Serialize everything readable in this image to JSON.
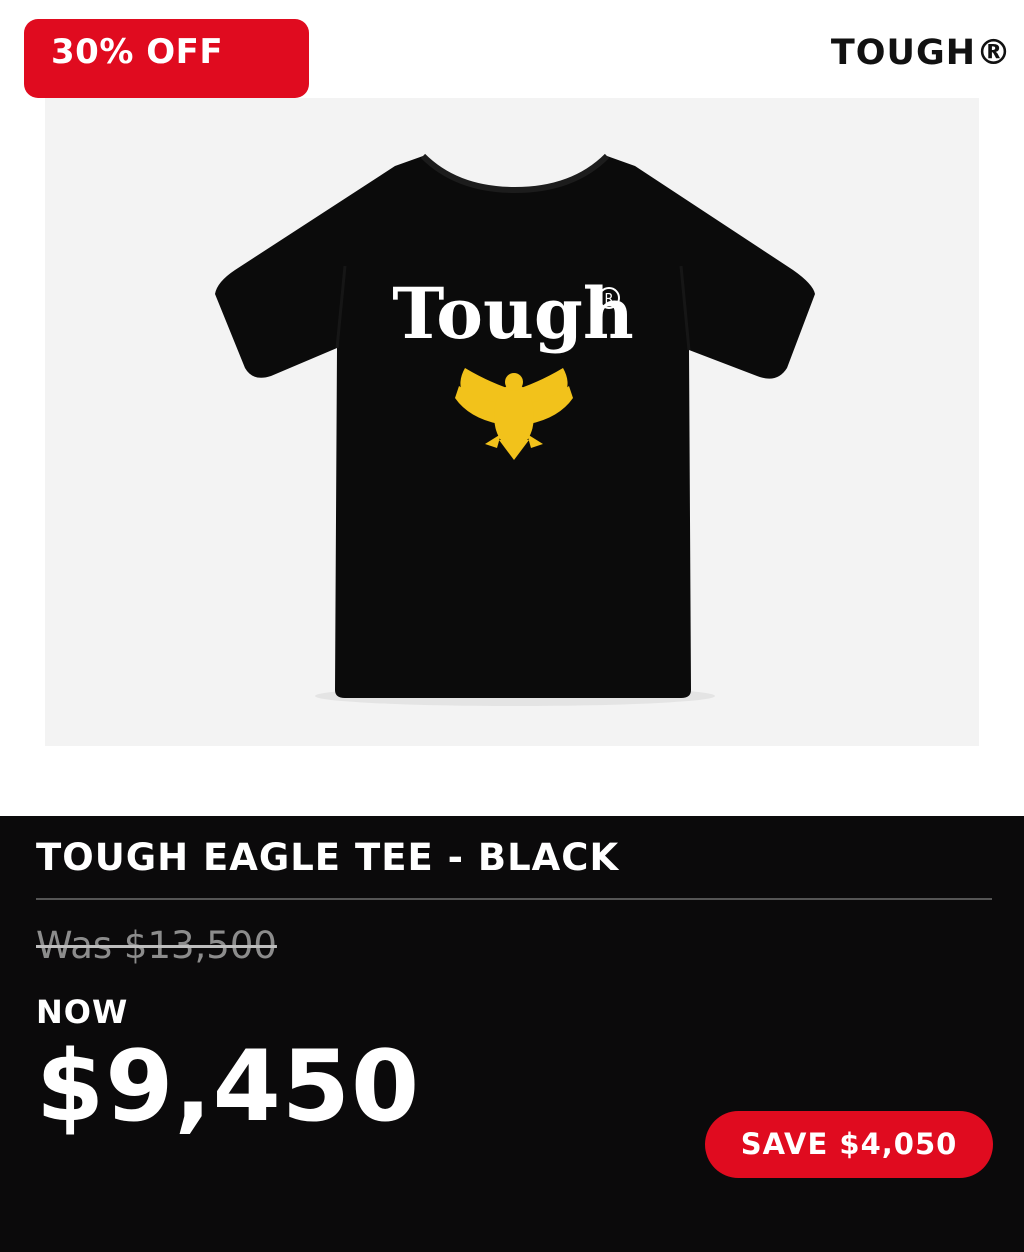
{
  "badge": {
    "discount_label": "30% OFF"
  },
  "header": {
    "brand": "TOUGH®"
  },
  "product_image": {
    "description_icon": "t-shirt-photo",
    "shirt_print_text": "Tough",
    "shirt_color": "#0a0a0a",
    "print_color": "#ffffff",
    "eagle_color": "#f2c21b"
  },
  "product": {
    "title": "TOUGH EAGLE TEE - BLACK",
    "was_price": "Was $13,500",
    "now_label": "NOW",
    "now_price": "$9,450",
    "save_label": "SAVE $4,050"
  },
  "colors": {
    "accent_red": "#e00b1f",
    "panel_black": "#0b0a0b",
    "was_price_gray": "#8c8c8c"
  }
}
